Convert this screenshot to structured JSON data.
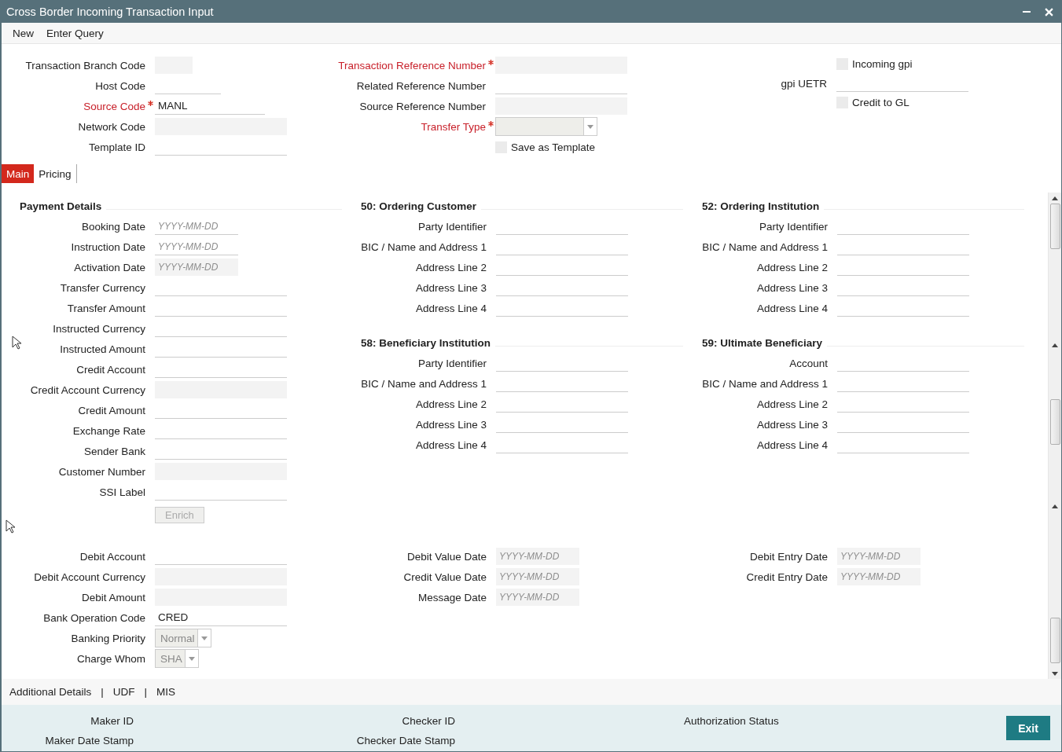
{
  "window": {
    "title": "Cross Border Incoming Transaction Input"
  },
  "menu": [
    "New",
    "Enter Query"
  ],
  "header": {
    "columns": [
      [
        {
          "kind": "text",
          "label": "Transaction Branch Code",
          "required": false,
          "disabled": true
        },
        {
          "kind": "text",
          "label": "Host Code",
          "required": false,
          "disabled": false
        },
        {
          "kind": "text",
          "label": "Source Code",
          "required": true,
          "disabled": false,
          "value": "MANL"
        },
        {
          "kind": "text",
          "label": "Network Code",
          "required": false,
          "disabled": true
        },
        {
          "kind": "text",
          "label": "Template ID",
          "required": false,
          "disabled": false
        }
      ],
      [
        {
          "kind": "text",
          "label": "Transaction Reference Number",
          "required": true,
          "disabled": true
        },
        {
          "kind": "text",
          "label": "Related Reference Number",
          "required": false,
          "disabled": false
        },
        {
          "kind": "text",
          "label": "Source Reference Number",
          "required": false,
          "disabled": true
        },
        {
          "kind": "select",
          "label": "Transfer Type",
          "required": true,
          "disabled": true
        },
        {
          "kind": "checkbox",
          "label": "Save as Template",
          "checked": false
        }
      ],
      [
        {
          "kind": "checkbox",
          "label": "Incoming gpi",
          "checked": false
        },
        {
          "kind": "text",
          "label": "gpi UETR",
          "required": false,
          "disabled": false
        },
        {
          "kind": "checkbox",
          "label": "Credit to GL",
          "checked": false
        }
      ]
    ]
  },
  "tabs": [
    {
      "label": "Main",
      "selected": true
    },
    {
      "label": "Pricing",
      "selected": false
    }
  ],
  "main": {
    "columns": [
      [
        {
          "title": "Payment Details",
          "fields": [
            {
              "kind": "date",
              "label": "Booking Date",
              "required": false,
              "disabled": false,
              "placeholder": "YYYY-MM-DD"
            },
            {
              "kind": "date",
              "label": "Instruction Date",
              "required": false,
              "disabled": false,
              "placeholder": "YYYY-MM-DD"
            },
            {
              "kind": "date",
              "label": "Activation Date",
              "required": false,
              "disabled": true,
              "placeholder": "YYYY-MM-DD"
            },
            {
              "kind": "text",
              "label": "Transfer Currency",
              "required": false,
              "disabled": false
            },
            {
              "kind": "text",
              "label": "Transfer Amount",
              "required": false,
              "disabled": false
            },
            {
              "kind": "text",
              "label": "Instructed Currency",
              "required": false,
              "disabled": false
            },
            {
              "kind": "text",
              "label": "Instructed Amount",
              "required": false,
              "disabled": false
            },
            {
              "kind": "text",
              "label": "Credit Account",
              "required": false,
              "disabled": false
            },
            {
              "kind": "text",
              "label": "Credit Account Currency",
              "required": false,
              "disabled": true
            },
            {
              "kind": "text",
              "label": "Credit Amount",
              "required": false,
              "disabled": false
            },
            {
              "kind": "text",
              "label": "Exchange Rate",
              "required": false,
              "disabled": false
            },
            {
              "kind": "text",
              "label": "Sender Bank",
              "required": false,
              "disabled": false
            },
            {
              "kind": "text",
              "label": "Customer Number",
              "required": false,
              "disabled": true
            },
            {
              "kind": "text",
              "label": "SSI Label",
              "required": false,
              "disabled": false
            },
            {
              "kind": "button",
              "label": "Enrich",
              "disabled": true
            }
          ]
        }
      ],
      [
        {
          "title": "50: Ordering Customer",
          "fields": [
            {
              "kind": "text",
              "label": "Party Identifier",
              "required": false,
              "disabled": false
            },
            {
              "kind": "text",
              "label": "BIC / Name and Address 1",
              "required": false,
              "disabled": false
            },
            {
              "kind": "text",
              "label": "Address Line 2",
              "required": false,
              "disabled": false
            },
            {
              "kind": "text",
              "label": "Address Line 3",
              "required": false,
              "disabled": false
            },
            {
              "kind": "text",
              "label": "Address Line 4",
              "required": false,
              "disabled": false
            }
          ]
        },
        {
          "title": "58: Beneficiary Institution",
          "fields": [
            {
              "kind": "text",
              "label": "Party Identifier",
              "required": false,
              "disabled": false
            },
            {
              "kind": "text",
              "label": "BIC / Name and Address 1",
              "required": false,
              "disabled": false
            },
            {
              "kind": "text",
              "label": "Address Line 2",
              "required": false,
              "disabled": false
            },
            {
              "kind": "text",
              "label": "Address Line 3",
              "required": false,
              "disabled": false
            },
            {
              "kind": "text",
              "label": "Address Line 4",
              "required": false,
              "disabled": false
            }
          ]
        }
      ],
      [
        {
          "title": "52: Ordering Institution",
          "fields": [
            {
              "kind": "text",
              "label": "Party Identifier",
              "required": false,
              "disabled": false
            },
            {
              "kind": "text",
              "label": "BIC / Name and Address 1",
              "required": false,
              "disabled": false
            },
            {
              "kind": "text",
              "label": "Address Line 2",
              "required": false,
              "disabled": false
            },
            {
              "kind": "text",
              "label": "Address Line 3",
              "required": false,
              "disabled": false
            },
            {
              "kind": "text",
              "label": "Address Line 4",
              "required": false,
              "disabled": false
            }
          ]
        },
        {
          "title": "59: Ultimate Beneficiary",
          "fields": [
            {
              "kind": "text",
              "label": "Account",
              "required": false,
              "disabled": false
            },
            {
              "kind": "text",
              "label": "BIC / Name and Address 1",
              "required": false,
              "disabled": false
            },
            {
              "kind": "text",
              "label": "Address Line 2",
              "required": false,
              "disabled": false
            },
            {
              "kind": "text",
              "label": "Address Line 3",
              "required": false,
              "disabled": false
            },
            {
              "kind": "text",
              "label": "Address Line 4",
              "required": false,
              "disabled": false
            }
          ]
        }
      ]
    ],
    "lower": [
      [
        {
          "kind": "text",
          "label": "Debit Account",
          "required": false,
          "disabled": false
        },
        {
          "kind": "text",
          "label": "Debit Account Currency",
          "required": false,
          "disabled": true
        },
        {
          "kind": "text",
          "label": "Debit Amount",
          "required": false,
          "disabled": true
        },
        {
          "kind": "text",
          "label": "Bank Operation Code",
          "required": false,
          "disabled": false,
          "value": "CRED"
        },
        {
          "kind": "select",
          "label": "Banking Priority",
          "required": false,
          "disabled": true,
          "value": "Normal"
        },
        {
          "kind": "select",
          "label": "Charge Whom",
          "required": false,
          "disabled": true,
          "value": "SHA"
        }
      ],
      [
        {
          "kind": "date",
          "label": "Debit Value Date",
          "required": false,
          "disabled": true,
          "placeholder": "YYYY-MM-DD"
        },
        {
          "kind": "date",
          "label": "Credit Value Date",
          "required": false,
          "disabled": true,
          "placeholder": "YYYY-MM-DD"
        },
        {
          "kind": "date",
          "label": "Message Date",
          "required": false,
          "disabled": true,
          "placeholder": "YYYY-MM-DD"
        }
      ],
      [
        {
          "kind": "date",
          "label": "Debit Entry Date",
          "required": false,
          "disabled": true,
          "placeholder": "YYYY-MM-DD"
        },
        {
          "kind": "date",
          "label": "Credit Entry Date",
          "required": false,
          "disabled": true,
          "placeholder": "YYYY-MM-DD"
        }
      ]
    ]
  },
  "footer_links": {
    "items": [
      "Additional Details",
      "UDF",
      "MIS"
    ],
    "separator": "|"
  },
  "audit": [
    [
      "Maker ID",
      "Maker Date Stamp"
    ],
    [
      "Checker ID",
      "Checker Date Stamp"
    ],
    [
      "Authorization Status"
    ]
  ],
  "exit_button": "Exit"
}
